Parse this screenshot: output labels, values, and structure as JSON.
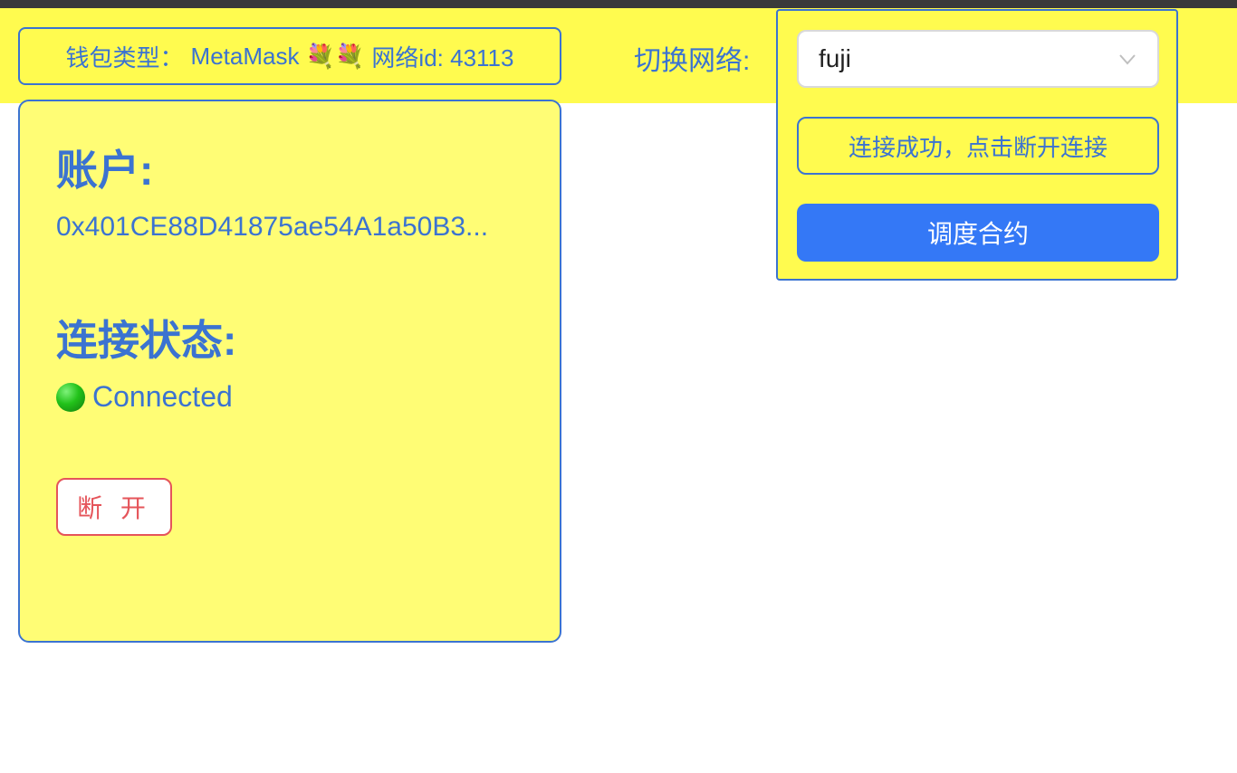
{
  "header": {
    "wallet_type_label": "钱包类型：",
    "wallet_name": "MetaMask 💐💐",
    "network_id_label": "网络id: 43113",
    "switch_network_label": "切换网络:"
  },
  "network_panel": {
    "selected_network": "fuji",
    "chevron_icon": "chevron-down-icon",
    "connected_button_label": "连接成功，点击断开连接",
    "dispatch_button_label": "调度合约"
  },
  "account_card": {
    "account_heading": "账户:",
    "account_address": "0x401CE88D41875ae54A1a50B3...",
    "status_heading": "连接状态:",
    "status_icon": "green-circle-icon",
    "status_text": "Connected",
    "disconnect_button_label": "断 开"
  },
  "colors": {
    "header_bg": "#fffb4f",
    "card_bg": "#fffd75",
    "accent": "#3b73d1",
    "primary_button": "#3478f6",
    "danger": "#e5545a",
    "status_green": "#22c21a"
  }
}
